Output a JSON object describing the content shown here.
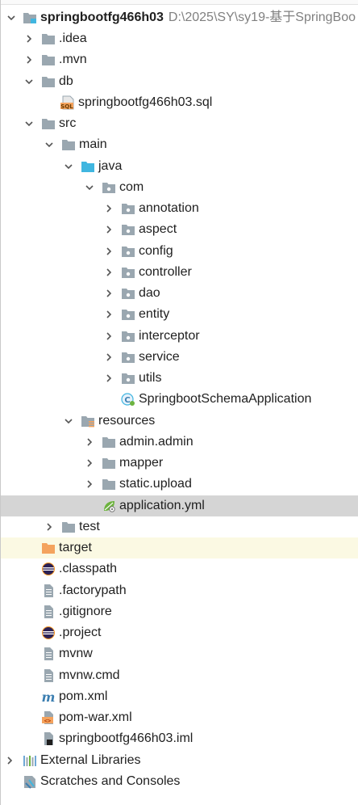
{
  "tree": {
    "root": {
      "name": "springbootfg466h03",
      "path": "D:\\2025\\SY\\sy19-基于SpringBoo"
    },
    "items": [
      {
        "label": ".idea"
      },
      {
        "label": ".mvn"
      },
      {
        "label": "db"
      },
      {
        "label": "springbootfg466h03.sql"
      },
      {
        "label": "src"
      },
      {
        "label": "main"
      },
      {
        "label": "java"
      },
      {
        "label": "com"
      },
      {
        "label": "annotation"
      },
      {
        "label": "aspect"
      },
      {
        "label": "config"
      },
      {
        "label": "controller"
      },
      {
        "label": "dao"
      },
      {
        "label": "entity"
      },
      {
        "label": "interceptor"
      },
      {
        "label": "service"
      },
      {
        "label": "utils"
      },
      {
        "label": "SpringbootSchemaApplication"
      },
      {
        "label": "resources"
      },
      {
        "label": "admin.admin"
      },
      {
        "label": "mapper"
      },
      {
        "label": "static.upload"
      },
      {
        "label": "application.yml"
      },
      {
        "label": "test"
      },
      {
        "label": "target"
      },
      {
        "label": ".classpath"
      },
      {
        "label": ".factorypath"
      },
      {
        "label": ".gitignore"
      },
      {
        "label": ".project"
      },
      {
        "label": "mvnw"
      },
      {
        "label": "mvnw.cmd"
      },
      {
        "label": "pom.xml"
      },
      {
        "label": "pom-war.xml"
      },
      {
        "label": "springbootfg466h03.iml"
      },
      {
        "label": "External Libraries"
      },
      {
        "label": "Scratches and Consoles"
      }
    ],
    "sql_badge": "SQL",
    "xml_badge": "<>",
    "maven_badge": "m"
  },
  "colors": {
    "folder_gray": "#9aa7b0",
    "folder_blue": "#40b6e0",
    "folder_orange": "#f4a35e",
    "selected_bg": "#d5d5d5",
    "highlight_bg": "#fbf9e3",
    "path_text": "#808080"
  }
}
